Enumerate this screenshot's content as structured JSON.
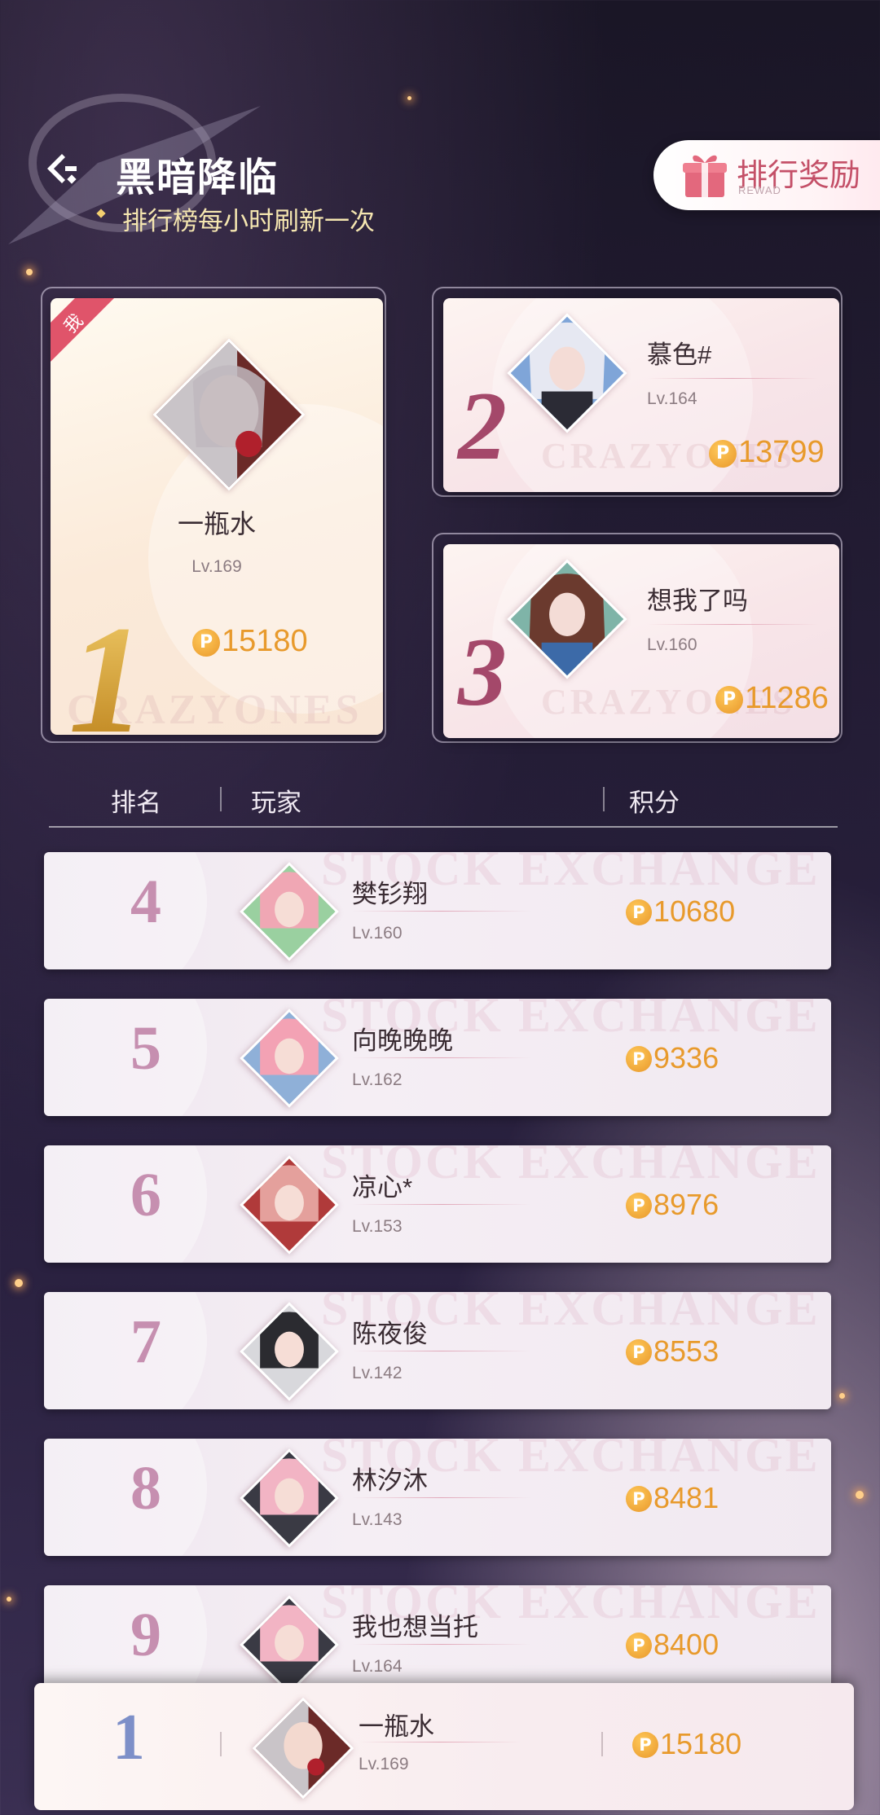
{
  "header": {
    "title": "黑暗降临",
    "subtitle": "排行榜每小时刷新一次",
    "reward_button": {
      "label": "排行奖励",
      "sub_label": "REWAD"
    }
  },
  "podium": [
    {
      "rank": "1",
      "name": "一瓶水",
      "level": "Lv.169",
      "score": "15180",
      "is_me": true,
      "me_tag": "我",
      "watermark": "CRAZYONES"
    },
    {
      "rank": "2",
      "name": "慕色#",
      "level": "Lv.164",
      "score": "13799",
      "watermark": "CRAZYONES"
    },
    {
      "rank": "3",
      "name": "想我了吗",
      "level": "Lv.160",
      "score": "11286",
      "watermark": "CRAZYONES"
    }
  ],
  "list_header": {
    "rank": "排名",
    "player": "玩家",
    "score": "积分"
  },
  "rows": [
    {
      "rank": "4",
      "name": "樊钐翔",
      "level": "Lv.160",
      "score": "10680"
    },
    {
      "rank": "5",
      "name": "向晚晚晚",
      "level": "Lv.162",
      "score": "9336"
    },
    {
      "rank": "6",
      "name": "凉心*",
      "level": "Lv.153",
      "score": "8976"
    },
    {
      "rank": "7",
      "name": "陈夜俊",
      "level": "Lv.142",
      "score": "8553"
    },
    {
      "rank": "8",
      "name": "林汐沐",
      "level": "Lv.143",
      "score": "8481"
    },
    {
      "rank": "9",
      "name": "我也想当托",
      "level": "Lv.164",
      "score": "8400"
    }
  ],
  "row_watermark": "STOCK EXCHANGE",
  "coin_symbol": "P",
  "my_rank": {
    "rank": "1",
    "name": "一瓶水",
    "level": "Lv.169",
    "score": "15180"
  },
  "colors": {
    "accent_pink": "#c45068",
    "gold_score": "#e89a2c",
    "rank_pink": "#c68fb0",
    "my_rank_blue": "#7d8fc8"
  }
}
